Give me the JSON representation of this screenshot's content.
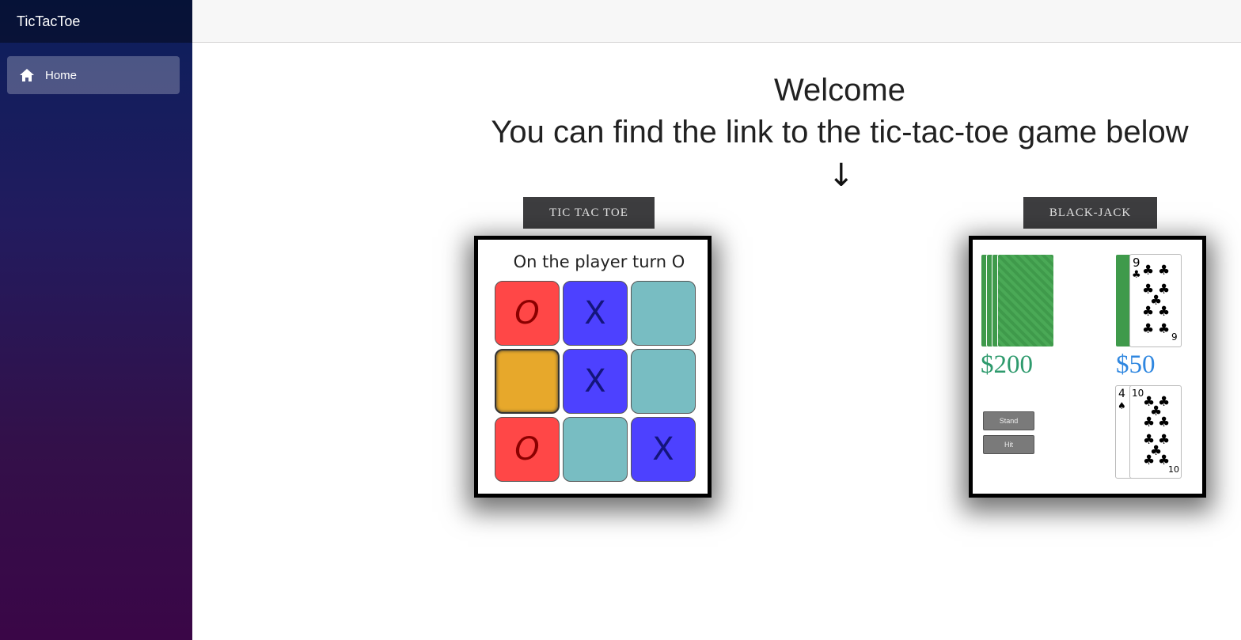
{
  "app": {
    "brand": "TicTacToe"
  },
  "sidebar": {
    "items": [
      {
        "label": "Home",
        "icon": "home-icon"
      }
    ]
  },
  "main": {
    "heading": "Welcome",
    "subheading": "You can find the link to the tic-tac-toe game below",
    "arrow": "↓"
  },
  "games": [
    {
      "button_label": "TIC TAC TOE",
      "preview": {
        "turn_text": "On the player turn O",
        "board": [
          "O",
          "X",
          "",
          "",
          "X",
          "",
          "O",
          "",
          "X"
        ]
      }
    },
    {
      "button_label": "BLACK-JACK",
      "preview": {
        "left_amount": "$200",
        "right_amount": "$50",
        "stand_label": "Stand",
        "hit_label": "Hit",
        "card_nine_rank": "9",
        "card_four_rank": "4",
        "card_ten_rank": "10",
        "suit_symbol": "♣",
        "spade_symbol": "♠"
      }
    }
  ],
  "colors": {
    "o_cell": "#ff4747",
    "x_cell": "#4d41ff",
    "empty_cell": "#78bdc2",
    "highlight_cell": "#e7a82b",
    "left_amount": "#2e9a6d",
    "right_amount": "#2f87e0"
  }
}
